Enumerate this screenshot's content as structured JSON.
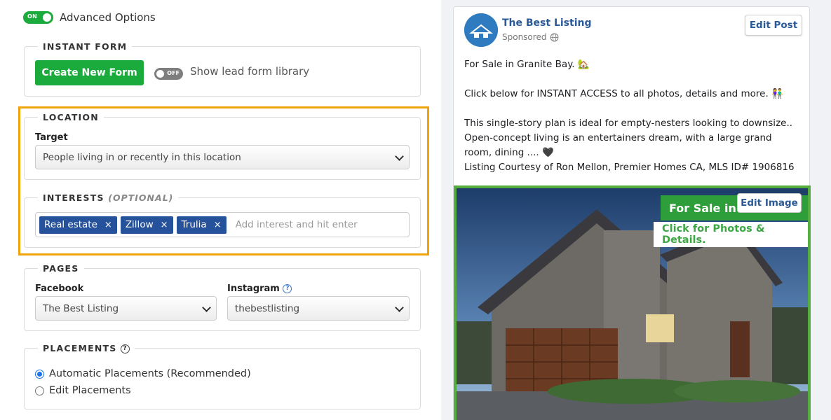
{
  "advanced": {
    "toggle_label": "ON",
    "label": "Advanced Options"
  },
  "instant_form": {
    "legend": "INSTANT FORM",
    "create_button": "Create New Form",
    "library_toggle": "OFF",
    "library_label": "Show lead form library"
  },
  "location": {
    "legend": "LOCATION",
    "target_label": "Target",
    "target_value": "People living in or recently in this location"
  },
  "interests": {
    "legend": "INTERESTS",
    "optional": "(OPTIONAL)",
    "tags": [
      "Real estate",
      "Zillow",
      "Trulia"
    ],
    "tag_remove": "×",
    "placeholder": "Add interest and hit enter"
  },
  "pages": {
    "legend": "PAGES",
    "facebook_label": "Facebook",
    "facebook_value": "The Best Listing",
    "instagram_label": "Instagram",
    "instagram_value": "thebestlisting"
  },
  "placements": {
    "legend": "PLACEMENTS",
    "options": [
      "Automatic Placements (Recommended)",
      "Edit Placements"
    ],
    "selected": 0
  },
  "preview": {
    "page_name": "The Best Listing",
    "sponsored": "Sponsored",
    "edit_post": "Edit Post",
    "line1": "For Sale in Granite Bay. 🏡",
    "line2": "Click below for INSTANT ACCESS to all photos, details and more. 👫",
    "line3": "This single-story plan is ideal for empty-nesters looking to downsize.. Open-concept living is an entertainers dream, with a large grand room, dining .... 🖤",
    "line4": "Listing Courtesy of Ron Mellon, Premier Homes CA, MLS ID# 1906816",
    "banner_top": "For Sale in G",
    "banner_bottom": "Click for Photos & Details.",
    "edit_image": "Edit Image"
  },
  "colors": {
    "accent_green": "#1aab3c",
    "tag_blue": "#25529a",
    "highlight": "#f0a30a",
    "link_blue": "#2a5a98"
  }
}
